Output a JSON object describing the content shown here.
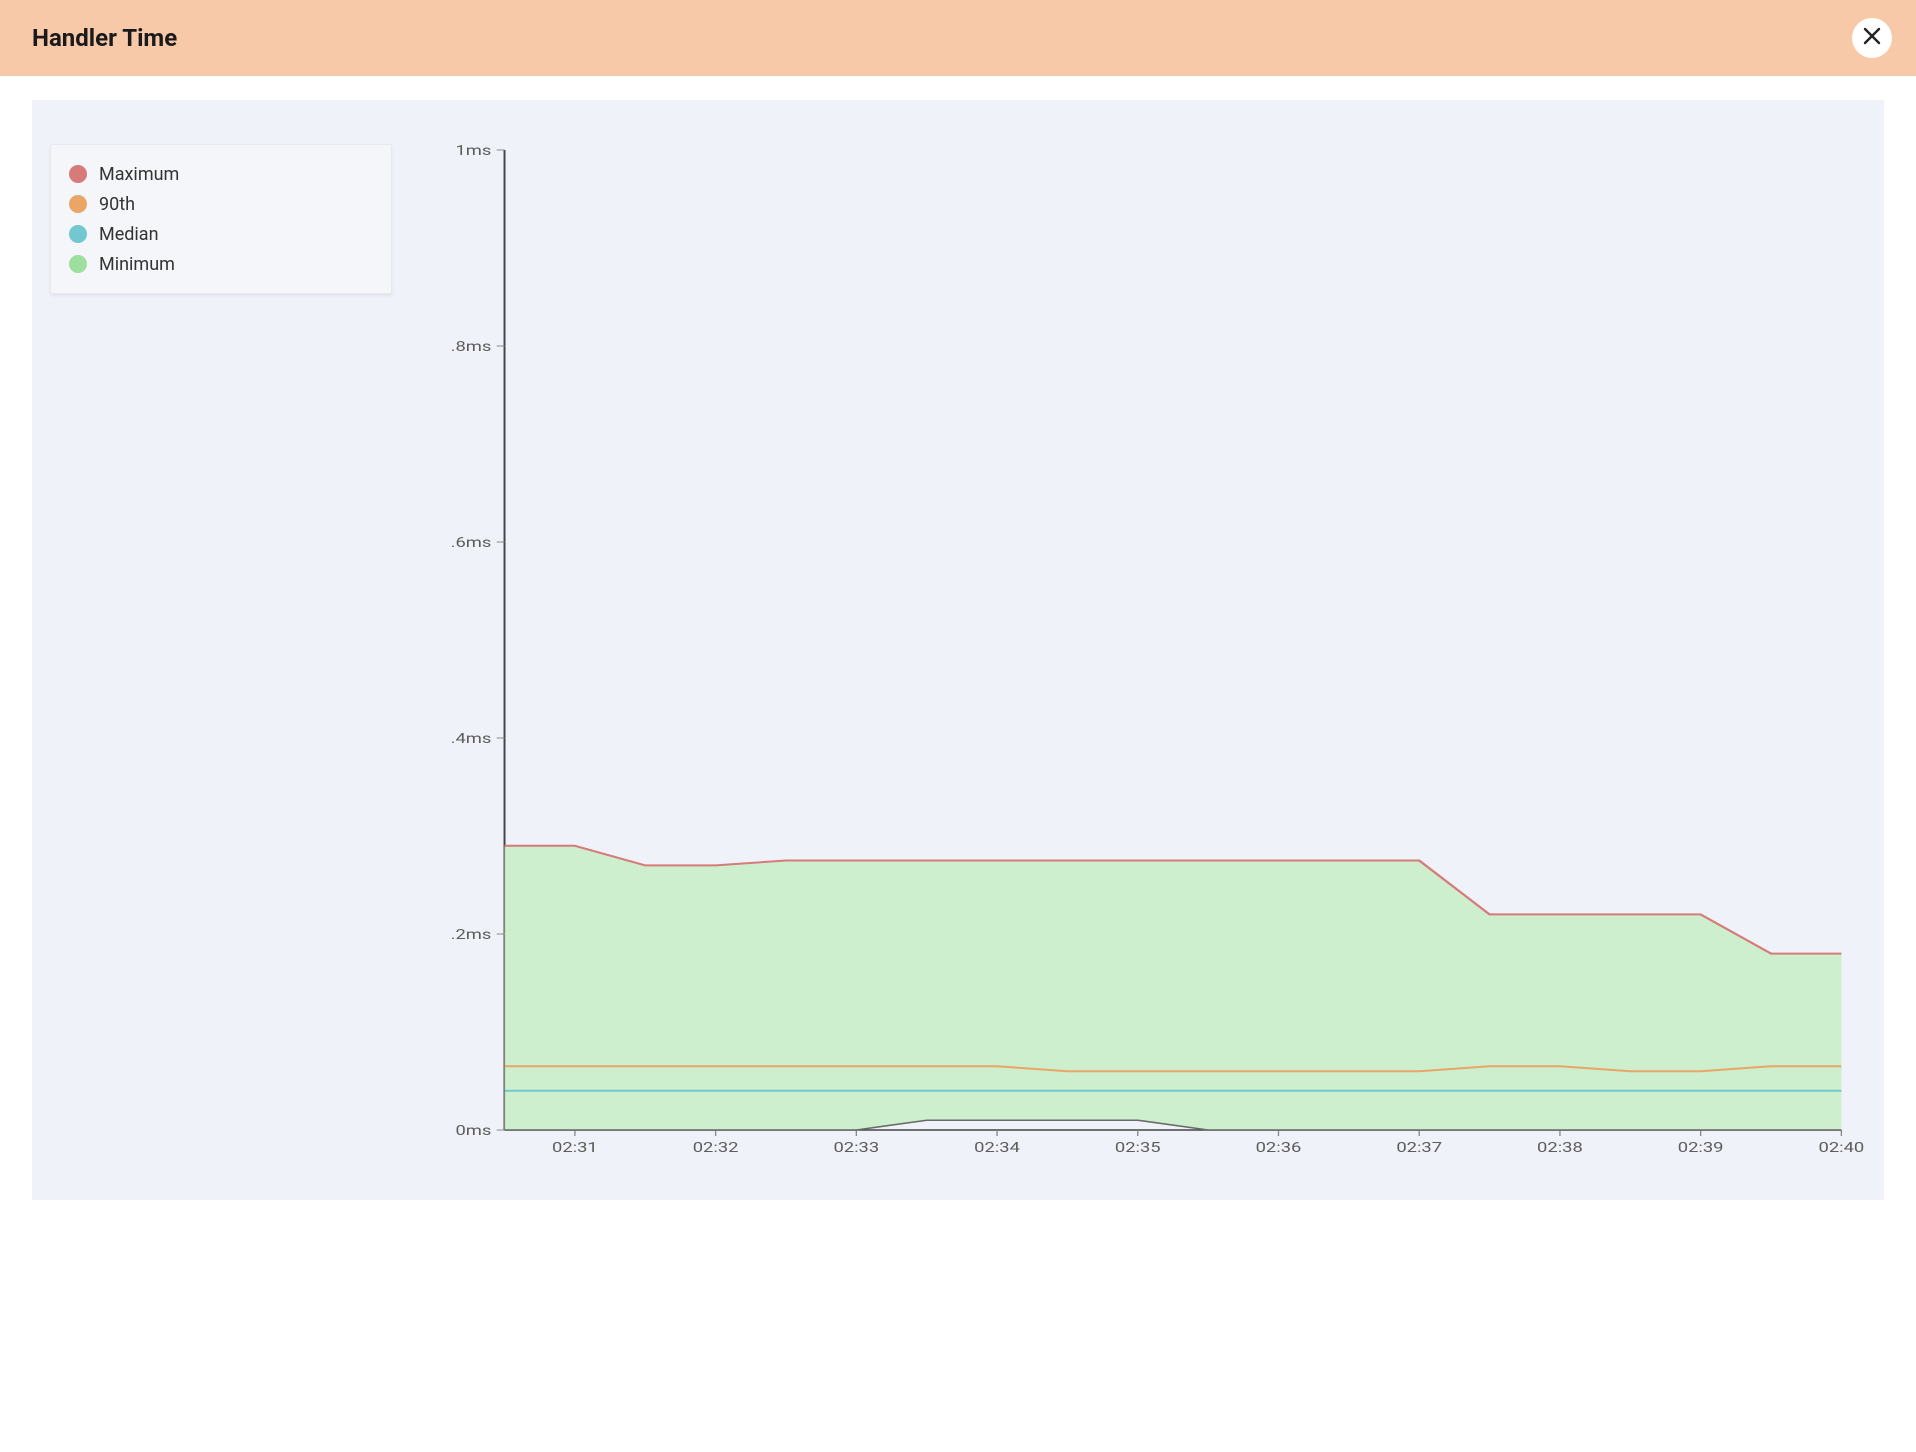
{
  "header": {
    "title": "Handler Time"
  },
  "legend": [
    {
      "name": "Maximum",
      "color": "#d67a7a"
    },
    {
      "name": "90th",
      "color": "#e9a667"
    },
    {
      "name": "Median",
      "color": "#72c7d1"
    },
    {
      "name": "Minimum",
      "color": "#9ddf9c"
    }
  ],
  "chart_data": {
    "type": "area",
    "title": "Handler Time",
    "xlabel": "",
    "ylabel": "",
    "ylim": [
      0,
      1
    ],
    "y_unit": "ms",
    "y_ticks": [
      {
        "value": 0.0,
        "label": "0ms"
      },
      {
        "value": 0.2,
        "label": ".2ms"
      },
      {
        "value": 0.4,
        "label": ".4ms"
      },
      {
        "value": 0.6,
        "label": ".6ms"
      },
      {
        "value": 0.8,
        "label": ".8ms"
      },
      {
        "value": 1.0,
        "label": "1ms"
      }
    ],
    "x_ticks": [
      "02:31",
      "02:32",
      "02:33",
      "02:34",
      "02:35",
      "02:36",
      "02:37",
      "02:38",
      "02:39",
      "02:40"
    ],
    "x": [
      "02:30.5",
      "02:31",
      "02:31.5",
      "02:32",
      "02:32.5",
      "02:33",
      "02:33.5",
      "02:34",
      "02:34.5",
      "02:35",
      "02:35.5",
      "02:36",
      "02:36.5",
      "02:37",
      "02:37.5",
      "02:38",
      "02:38.5",
      "02:39",
      "02:39.5",
      "02:40"
    ],
    "series": [
      {
        "name": "Maximum",
        "color": "#d67a7a",
        "values": [
          0.29,
          0.29,
          0.27,
          0.27,
          0.275,
          0.275,
          0.275,
          0.275,
          0.275,
          0.275,
          0.275,
          0.275,
          0.275,
          0.275,
          0.22,
          0.22,
          0.22,
          0.22,
          0.18,
          0.18
        ]
      },
      {
        "name": "90th",
        "color": "#e9a667",
        "values": [
          0.065,
          0.065,
          0.065,
          0.065,
          0.065,
          0.065,
          0.065,
          0.065,
          0.06,
          0.06,
          0.06,
          0.06,
          0.06,
          0.06,
          0.065,
          0.065,
          0.06,
          0.06,
          0.065,
          0.065
        ]
      },
      {
        "name": "Median",
        "color": "#72c7d1",
        "values": [
          0.04,
          0.04,
          0.04,
          0.04,
          0.04,
          0.04,
          0.04,
          0.04,
          0.04,
          0.04,
          0.04,
          0.04,
          0.04,
          0.04,
          0.04,
          0.04,
          0.04,
          0.04,
          0.04,
          0.04
        ]
      },
      {
        "name": "Minimum",
        "color": "#9ddf9c",
        "values": [
          0,
          0,
          0,
          0,
          0,
          0,
          0.01,
          0.01,
          0.01,
          0.01,
          0,
          0,
          0,
          0,
          0,
          0,
          0,
          0,
          0,
          0
        ]
      }
    ]
  }
}
